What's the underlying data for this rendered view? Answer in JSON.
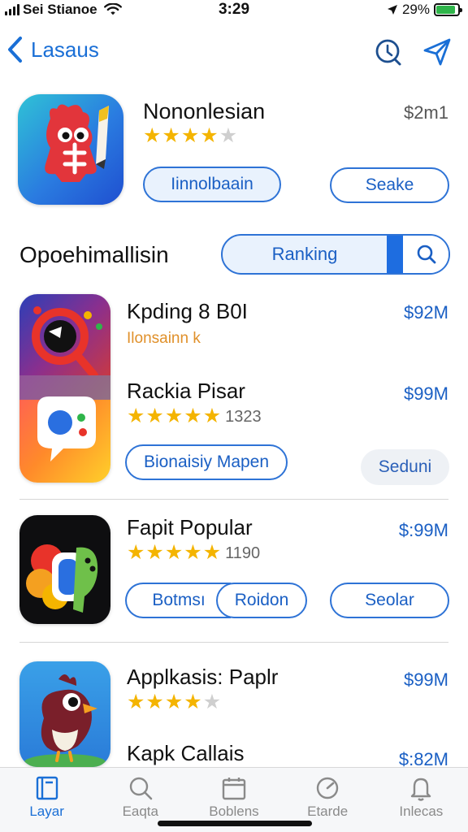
{
  "status": {
    "carrier": "Sei Stianoe",
    "time": "3:29",
    "battery": "29%",
    "battery_level": 0.9
  },
  "nav": {
    "back_label": "Lasaus",
    "icons": [
      "search-icon",
      "share-icon"
    ]
  },
  "featured": {
    "title": "Nononlesian",
    "price": "$2m1",
    "rating": 4,
    "primary_button": "Iinnolbaain",
    "secondary_button": "Seake"
  },
  "section": {
    "title": "Opoehimallisin",
    "segment_label": "Ranking"
  },
  "apps": [
    {
      "title": "Kpding 8 B0I",
      "subtitle": "Ilonsainn k",
      "price": "$92M"
    },
    {
      "title": "Rackia Pisar",
      "price": "$99M",
      "rating": 5,
      "count": "1323",
      "primary_button": "Bionaisiy Mapen",
      "secondary_button": "Seduni"
    },
    {
      "title": "Fapit Popular",
      "price": "$:99M",
      "rating": 5,
      "count": "1190",
      "button_left": "Botmsı",
      "button_right": "Roidon",
      "secondary_button": "Seolar"
    },
    {
      "title": "Applkasis: Paplr",
      "price": "$99M",
      "rating": 4
    },
    {
      "title": "Kapk Callais",
      "price": "$:82M"
    }
  ],
  "tabs": [
    {
      "label": "Layar",
      "icon": "book-icon",
      "active": true
    },
    {
      "label": "Eaqta",
      "icon": "search-icon",
      "active": false
    },
    {
      "label": "Boblens",
      "icon": "calendar-icon",
      "active": false
    },
    {
      "label": "Etarde",
      "icon": "gauge-icon",
      "active": false
    },
    {
      "label": "Inlecas",
      "icon": "bell-icon",
      "active": false
    }
  ],
  "colors": {
    "accent": "#1a6fd6",
    "star": "#f4b400",
    "tab_inactive": "#8a8a8a"
  }
}
